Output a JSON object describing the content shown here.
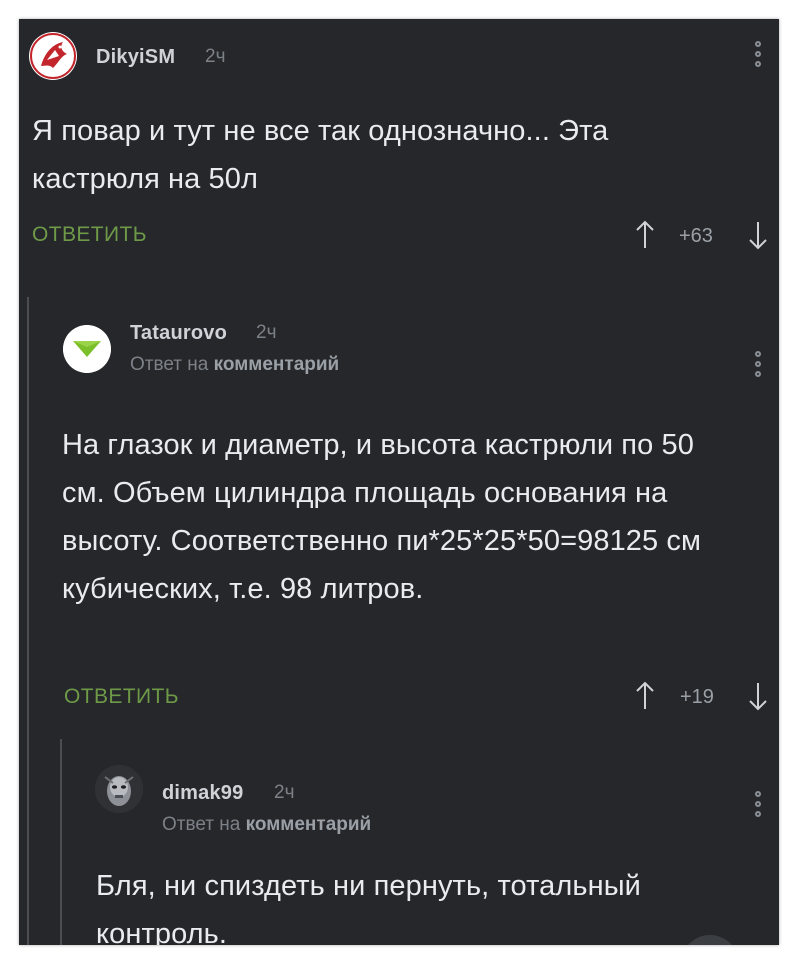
{
  "comments": [
    {
      "username": "DikyiSM",
      "time": "2ч",
      "text": "Я повар и тут не все так однозначно... Эта кастрюля на 50л",
      "reply_label": "ОТВЕТИТЬ",
      "score": "+63"
    },
    {
      "username": "Tataurovo",
      "time": "2ч",
      "reply_prefix": "Ответ на",
      "reply_target": "комментарий",
      "text": "На глазок и диаметр, и высота кастрюли по 50 см. Объем цилиндра площадь основания на высоту. Соответственно пи*25*25*50=98125 см кубических, т.е. 98 литров.",
      "reply_label": "ОТВЕТИТЬ",
      "score": "+19"
    },
    {
      "username": "dimak99",
      "time": "2ч",
      "reply_prefix": "Ответ на",
      "reply_target": "комментарий",
      "text": "Бля, ни спиздеть ни пернуть, тотальный контроль."
    }
  ],
  "colors": {
    "background": "#25272b",
    "reply_green": "#6e9a48",
    "text": "#e9ebee",
    "muted": "#7c8187"
  },
  "icons": [
    "dragon-avatar",
    "green-triangle-avatar",
    "robot-face-avatar",
    "vertical-dots-icon",
    "arrow-up-icon",
    "arrow-down-icon"
  ]
}
